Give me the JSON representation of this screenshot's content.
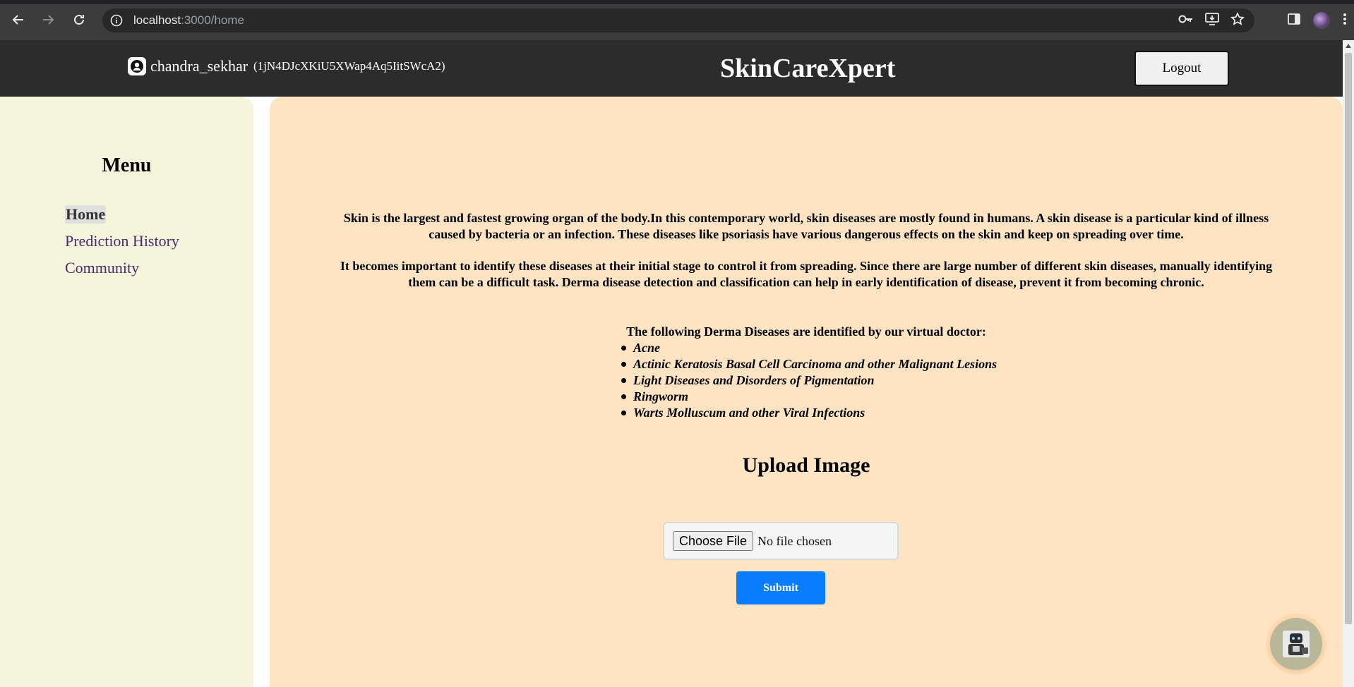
{
  "browser": {
    "url_host": "localhost",
    "url_path": ":3000/home"
  },
  "header": {
    "username": "chandra_sekhar",
    "user_id": "(1jN4DJcXKiU5XWap4Aq5IitSWcA2)",
    "brand": "SkinCareXpert",
    "logout_label": "Logout"
  },
  "sidebar": {
    "title": "Menu",
    "items": [
      {
        "label": "Home"
      },
      {
        "label": "Prediction History"
      },
      {
        "label": "Community"
      }
    ]
  },
  "main": {
    "paragraph1": "Skin is the largest and fastest growing organ of the body.In this contemporary world, skin diseases are mostly found in humans. A skin disease is a particular kind of illness caused by bacteria or an infection. These diseases like psoriasis have various dangerous effects on the skin and keep on spreading over time.",
    "paragraph2": "It becomes important to identify these diseases at their initial stage to control it from spreading. Since there are large number of different skin diseases, manually identifying them can be a difficult task. Derma disease detection and classification can help in early identification of disease, prevent it from becoming chronic.",
    "diseases_heading": "The following Derma Diseases are identified by our virtual doctor:",
    "diseases": [
      "Acne",
      "Actinic Keratosis Basal Cell Carcinoma and other Malignant Lesions",
      "Light Diseases and Disorders of Pigmentation",
      "Ringworm",
      "Warts Molluscum and other Viral Infections"
    ],
    "upload_title": "Upload Image",
    "choose_file_label": "Choose File",
    "no_file_text": "No file chosen",
    "submit_label": "Submit"
  },
  "colors": {
    "header_bg": "#2c2c2c",
    "sidebar_bg": "#f5f5dc",
    "main_bg": "#ffe4c4",
    "submit_bg": "#0a7cff",
    "menu_link": "#4b2a6e"
  }
}
